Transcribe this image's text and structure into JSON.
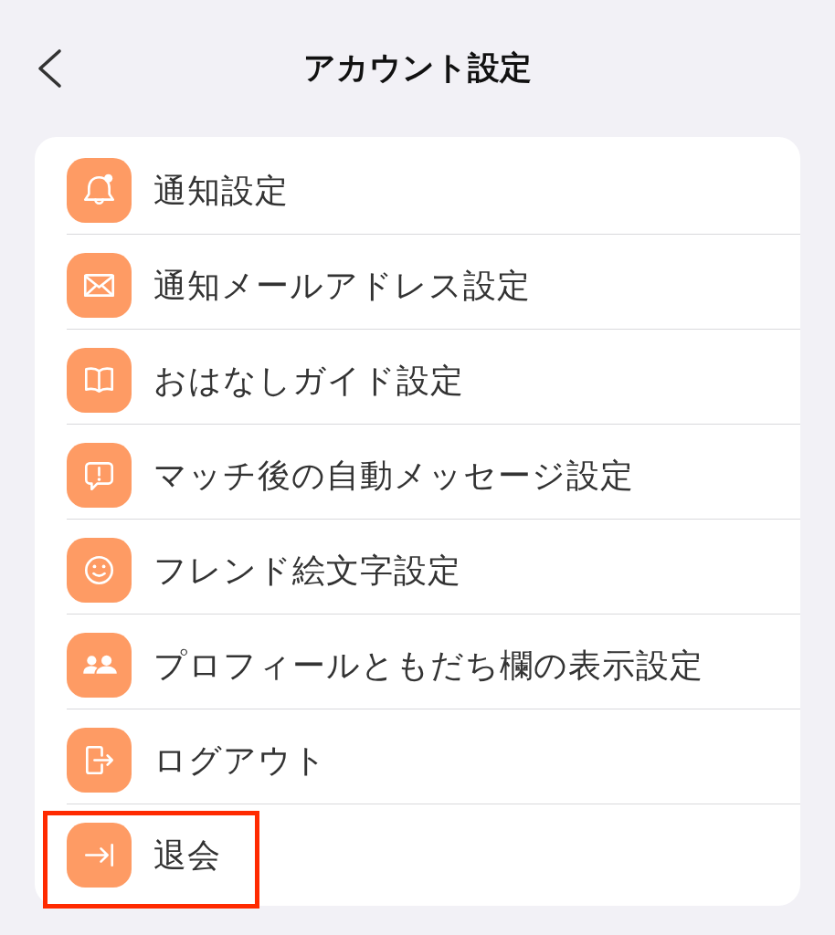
{
  "header": {
    "title": "アカウント設定"
  },
  "items": [
    {
      "label": "通知設定",
      "highlighted": false
    },
    {
      "label": "通知メールアドレス設定",
      "highlighted": false
    },
    {
      "label": "おはなしガイド設定",
      "highlighted": false
    },
    {
      "label": "マッチ後の自動メッセージ設定",
      "highlighted": false
    },
    {
      "label": "フレンド絵文字設定",
      "highlighted": false
    },
    {
      "label": "プロフィールともだち欄の表示設定",
      "highlighted": false
    },
    {
      "label": "ログアウト",
      "highlighted": false
    },
    {
      "label": "退会",
      "highlighted": true
    }
  ]
}
